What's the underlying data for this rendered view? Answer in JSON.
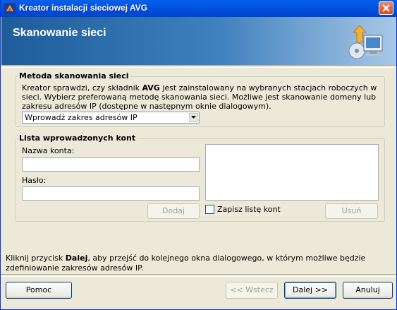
{
  "window": {
    "title": "Kreator instalacji sieciowej AVG",
    "close_icon": "close-icon",
    "app_icon": "avg-logo-icon"
  },
  "header": {
    "title": "Skanowanie sieci",
    "icon": "network-computer-icon"
  },
  "scan_method": {
    "legend": "Metoda skanowania sieci",
    "desc_part1": "Kreator sprawdzi, czy składnik ",
    "desc_bold": "AVG",
    "desc_part2": " jest zainstalowany na wybranych stacjach roboczych w sieci. Wybierz preferowaną metodę skanowania sieci. Możliwe jest skanowanie domeny lub zakresu adresów IP (dostępne w następnym oknie dialogowym).",
    "select_value": "Wprowadź zakres adresów IP"
  },
  "accounts": {
    "legend": "Lista wprowadzonych kont",
    "account_label": "Nazwa konta:",
    "account_value": "",
    "password_label": "Hasło:",
    "password_value": "",
    "add_button": "Dodaj",
    "save_list_label": "Zapisz listę kont",
    "save_list_checked": false,
    "remove_button": "Usuń",
    "entries": []
  },
  "note": {
    "part1": "Kliknij przycisk ",
    "bold": "Dalej",
    "part2": ", aby przejść do kolejnego okna dialogowego, w którym możliwe będzie zdefiniowanie zakresów adresów IP."
  },
  "buttons": {
    "help": "Pomoc",
    "back": "<< Wstecz",
    "next": "Dalej >>",
    "cancel": "Anuluj"
  }
}
